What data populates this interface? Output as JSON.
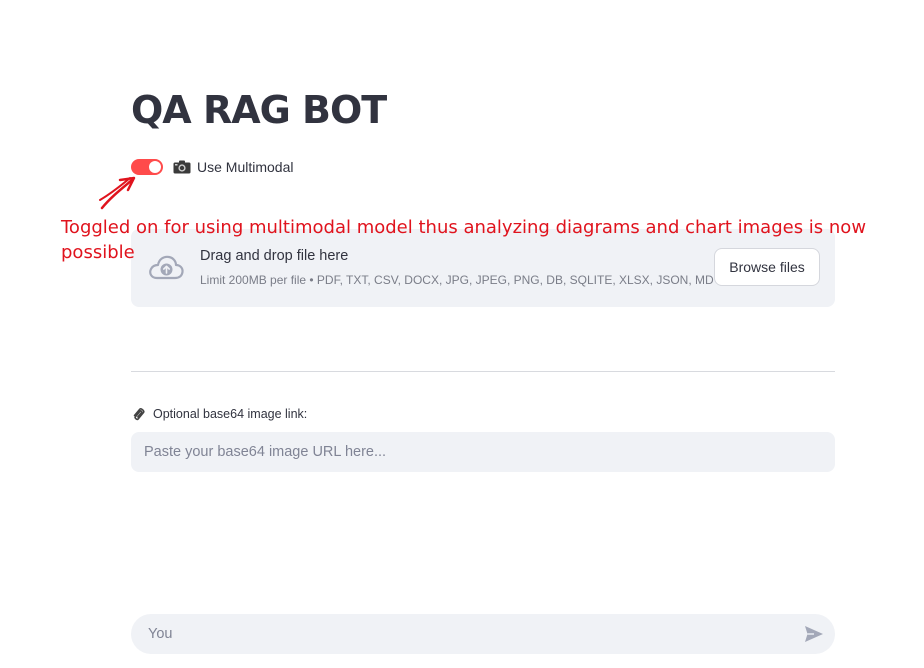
{
  "page": {
    "title": "QA RAG BOT"
  },
  "multimodal_toggle": {
    "label": "Use Multimodal",
    "on": true,
    "accent": "#ff4b4b"
  },
  "annotation": {
    "text": "Toggled on for using multimodal model thus analyzing diagrams and chart images is now possible",
    "color": "#e0131d"
  },
  "uploader": {
    "title": "Drag and drop file here",
    "limit_text": "Limit 200MB per file • PDF, TXT, CSV, DOCX, JPG, JPEG, PNG, DB, SQLITE, XLSX, JSON, MD",
    "browse_label": "Browse files",
    "icon": "cloud-upload-icon"
  },
  "image_link": {
    "label": "Optional base64 image link:",
    "placeholder": "Paste your base64 image URL here...",
    "value": "",
    "icon": "paperclip-icon"
  },
  "chat": {
    "placeholder": "You",
    "send_icon": "send-icon"
  }
}
